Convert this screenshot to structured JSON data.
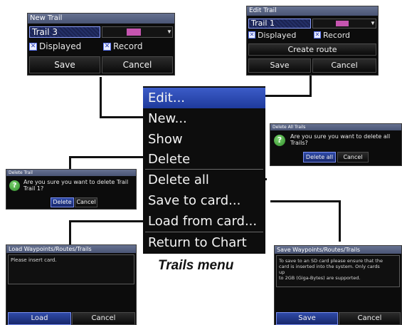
{
  "new_trail": {
    "title": "New Trail",
    "name_value": "Trail 3",
    "displayed_label": "Displayed",
    "record_label": "Record",
    "save_label": "Save",
    "cancel_label": "Cancel"
  },
  "edit_trail": {
    "title": "Edit Trail",
    "name_value": "Trail 1",
    "displayed_label": "Displayed",
    "record_label": "Record",
    "create_route_label": "Create route",
    "save_label": "Save",
    "cancel_label": "Cancel"
  },
  "trails_menu": {
    "items": [
      {
        "label": "Edit..."
      },
      {
        "label": "New..."
      },
      {
        "label": "Show"
      },
      {
        "label": "Delete"
      },
      {
        "label": "Delete all"
      },
      {
        "label": "Save to card..."
      },
      {
        "label": "Load from card..."
      },
      {
        "label": "Return to Chart"
      }
    ],
    "caption": "Trails menu"
  },
  "delete_all": {
    "title": "Delete All Trails",
    "message": "Are you sure you want to delete all\nTrails?",
    "delete_label": "Delete all",
    "cancel_label": "Cancel"
  },
  "delete_trail": {
    "title": "Delete Trail",
    "message": "Are you sure you want to delete Trail\nTrail 1?",
    "delete_label": "Delete",
    "cancel_label": "Cancel"
  },
  "load_dialog": {
    "title": "Load Waypoints/Routes/Trails",
    "message": "Please insert card.",
    "load_label": "Load",
    "cancel_label": "Cancel"
  },
  "save_dialog": {
    "title": "Save Waypoints/Routes/Trails",
    "message": "To save to an SD card please ensure that the\ncard is inserted into the system. Only cards\nup\nto 2GB (Giga-Bytes) are supported.",
    "save_label": "Save",
    "cancel_label": "Cancel"
  },
  "colors": {
    "menu_highlight": "#2f4fba",
    "title_bar": "#59627f",
    "trail_color": "#c655b0",
    "confirm_icon": "#3d9c35"
  },
  "icons": [
    "checkbox-icon",
    "dropdown-arrow-icon",
    "question-icon"
  ]
}
